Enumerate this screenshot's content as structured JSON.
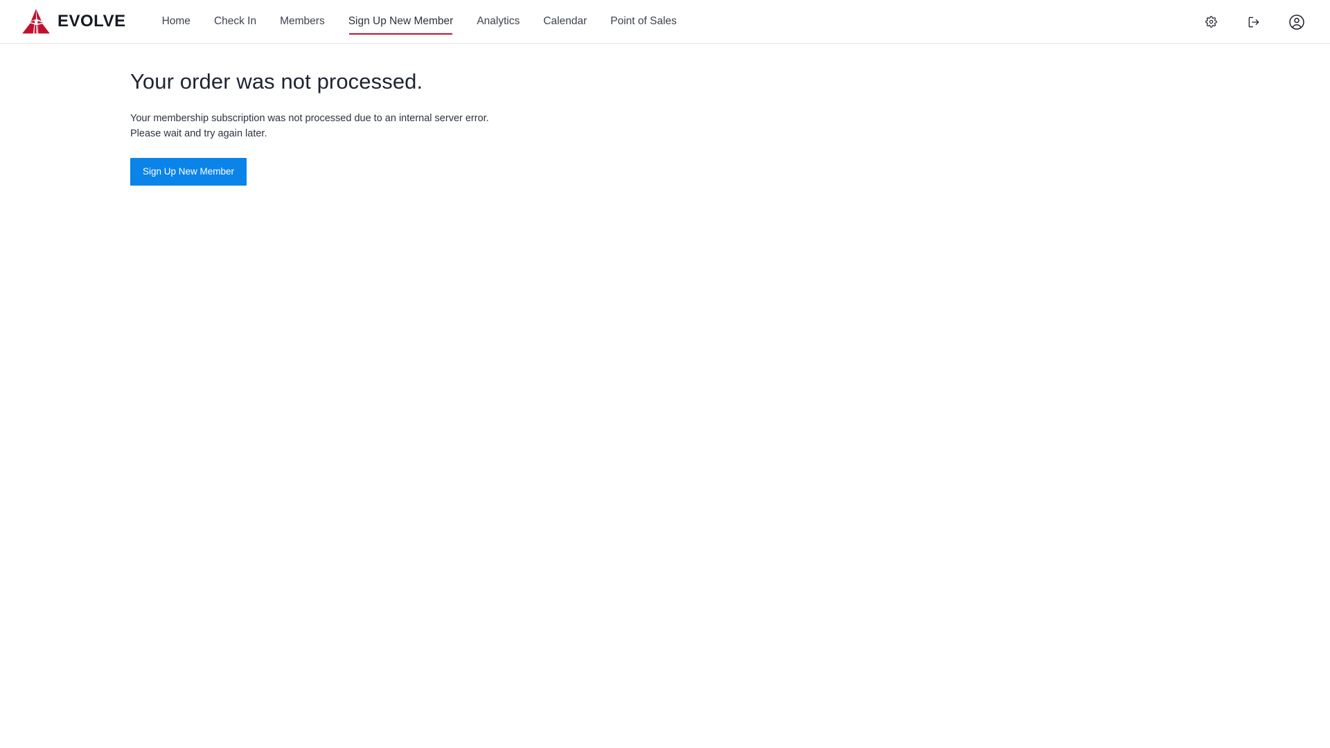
{
  "brand": {
    "name": "EVOLVE",
    "logo_icon": "evolve-triangle-logo",
    "logo_color": "#c1102e"
  },
  "theme": {
    "accent": "#c8102e",
    "button_blue": "#0a84e8",
    "text": "#2b3240",
    "header_border": "#e6e6e6"
  },
  "nav": {
    "items": [
      {
        "label": "Home",
        "active": false
      },
      {
        "label": "Check In",
        "active": false
      },
      {
        "label": "Members",
        "active": false
      },
      {
        "label": "Sign Up New Member",
        "active": true
      },
      {
        "label": "Analytics",
        "active": false
      },
      {
        "label": "Calendar",
        "active": false
      },
      {
        "label": "Point of Sales",
        "active": false
      }
    ]
  },
  "header_actions": [
    {
      "name": "settings-button",
      "icon": "gear-icon",
      "label": "Settings"
    },
    {
      "name": "logout-button",
      "icon": "logout-icon",
      "label": "Log out"
    },
    {
      "name": "account-button",
      "icon": "user-circle-icon",
      "label": "Account"
    }
  ],
  "main": {
    "title": "Your order was not processed.",
    "message_line1": "Your membership subscription was not processed due to an internal server error.",
    "message_line2": "Please wait and try again later.",
    "cta_label": "Sign Up New Member"
  }
}
